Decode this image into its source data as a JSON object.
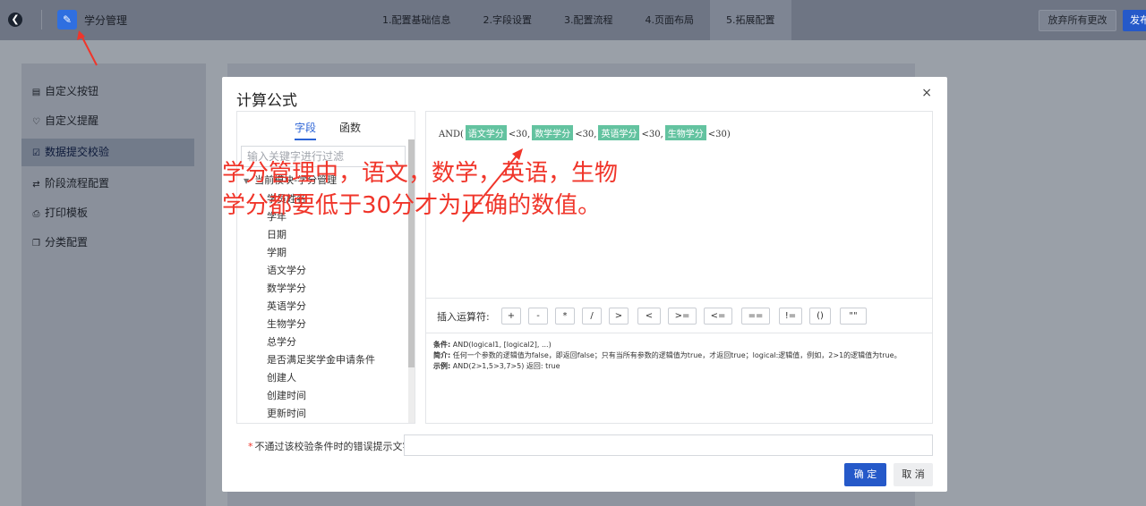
{
  "header": {
    "app_title": "学分管理",
    "steps": [
      "1.配置基础信息",
      "2.字段设置",
      "3.配置流程",
      "4.页面布局",
      "5.拓展配置"
    ],
    "active_step": 4,
    "discard_label": "放弃所有更改",
    "publish_label": "发布"
  },
  "sidebar": {
    "items": [
      {
        "label": "自定义按钮",
        "icon": "button-icon"
      },
      {
        "label": "自定义提醒",
        "icon": "reminder-icon"
      },
      {
        "label": "数据提交校验",
        "icon": "validation-icon",
        "active": true
      },
      {
        "label": "阶段流程配置",
        "icon": "workflow-icon"
      },
      {
        "label": "打印模板",
        "icon": "print-icon"
      },
      {
        "label": "分类配置",
        "icon": "category-icon"
      }
    ]
  },
  "modal": {
    "title": "计算公式",
    "close": "×",
    "tabs": [
      "字段",
      "函数"
    ],
    "filter_placeholder": "输入关键字进行过滤",
    "tree_module": "当前模块-学分管理",
    "fields": [
      "学员姓名",
      "学年",
      "日期",
      "学期",
      "语文学分",
      "数学学分",
      "英语学分",
      "生物学分",
      "总学分",
      "是否满足奖学金申请条件",
      "创建人",
      "创建时间",
      "更新时间"
    ],
    "formula": {
      "fn": "AND(",
      "parts": [
        {
          "tag": "语文学分",
          "rest": "<30,"
        },
        {
          "tag": "数学学分",
          "rest": "<30,"
        },
        {
          "tag": "英语学分",
          "rest": "<30,"
        },
        {
          "tag": "生物学分",
          "rest": "<30)"
        }
      ]
    },
    "operators_label": "插入运算符:",
    "operators": [
      "+",
      "-",
      "*",
      "/",
      ">",
      "<",
      ">=",
      "<=",
      "==",
      "!=",
      "()",
      "\"\""
    ],
    "desc": {
      "cond_label": "条件:",
      "cond": "AND(logical1, [logical2], ...)",
      "intro_label": "简介:",
      "intro": "任何一个参数的逻辑值为false，即返回false；只有当所有参数的逻辑值为true，才返回true；logical:逻辑值，例如，2>1的逻辑值为true。",
      "example_label": "示例:",
      "example": "AND(2>1,5>3,7>5) 返回: true"
    },
    "error_label": "不通过该校验条件时的错误提示文字",
    "ok_label": "确 定",
    "cancel_label": "取 消"
  },
  "annotation": {
    "line1": "学分管理中，语文，数学，英语，生物",
    "line2": "学分都要低于30分才为正确的数值。",
    "color": "#f0352a"
  }
}
